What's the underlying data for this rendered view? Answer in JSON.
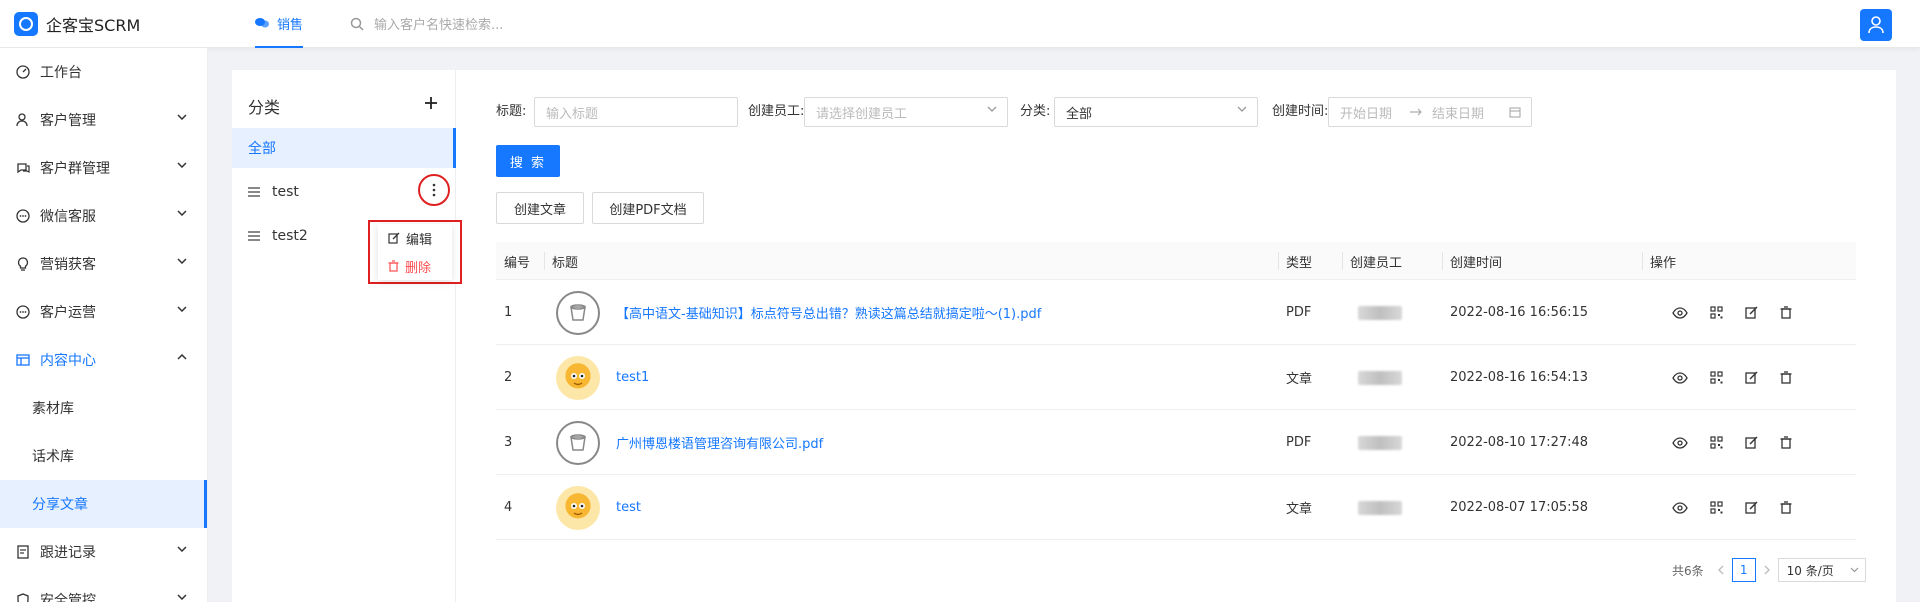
{
  "app": {
    "title": "企客宝SCRM"
  },
  "topbar": {
    "tab_label": "销售",
    "search_placeholder": "输入客户名快速检索..."
  },
  "sidebar": {
    "items": [
      {
        "label": "工作台",
        "icon": "dashboard-icon"
      },
      {
        "label": "客户管理",
        "icon": "user-icon"
      },
      {
        "label": "客户群管理",
        "icon": "chat-icon"
      },
      {
        "label": "微信客服",
        "icon": "message-icon"
      },
      {
        "label": "营销获客",
        "icon": "bulb-icon"
      },
      {
        "label": "客户运营",
        "icon": "message-icon"
      },
      {
        "label": "内容中心",
        "icon": "folder-icon"
      },
      {
        "label": "跟进记录",
        "icon": "note-icon"
      },
      {
        "label": "安全管控",
        "icon": "shield-icon"
      }
    ],
    "sub_items": [
      {
        "label": "素材库"
      },
      {
        "label": "话术库"
      },
      {
        "label": "分享文章",
        "active": true
      }
    ]
  },
  "categories": {
    "title": "分类",
    "items": [
      {
        "label": "全部",
        "active": true
      },
      {
        "label": "test"
      },
      {
        "label": "test2"
      }
    ],
    "context_menu": {
      "edit": "编辑",
      "delete": "删除"
    }
  },
  "filters": {
    "title_label": "标题:",
    "title_placeholder": "输入标题",
    "creator_label": "创建员工:",
    "creator_placeholder": "请选择创建员工",
    "category_label": "分类:",
    "category_value": "全部",
    "time_label": "创建时间:",
    "start_placeholder": "开始日期",
    "end_placeholder": "结束日期",
    "search_button": "搜 索",
    "create_article_button": "创建文章",
    "create_pdf_button": "创建PDF文档"
  },
  "table": {
    "headers": [
      "编号",
      "标题",
      "类型",
      "创建员工",
      "创建时间",
      "操作"
    ],
    "rows": [
      {
        "id": "1",
        "thumb": "pdf",
        "title": "【高中语文-基础知识】标点符号总出错？熟读这篇总结就搞定啦～(1).pdf",
        "type": "PDF",
        "time": "2022-08-16 16:56:15"
      },
      {
        "id": "2",
        "thumb": "cat",
        "title": "test1",
        "type": "文章",
        "time": "2022-08-16 16:54:13"
      },
      {
        "id": "3",
        "thumb": "pdf",
        "title": "广州博恩楼语管理咨询有限公司.pdf",
        "type": "PDF",
        "time": "2022-08-10 17:27:48"
      },
      {
        "id": "4",
        "thumb": "cat",
        "title": "test",
        "type": "文章",
        "time": "2022-08-07 17:05:58"
      }
    ]
  },
  "pagination": {
    "total": "共6条",
    "current": "1",
    "page_size": "10 条/页"
  },
  "colors": {
    "accent": "#1677ff",
    "danger": "#ff4d4f",
    "highlight": "#e02020"
  }
}
